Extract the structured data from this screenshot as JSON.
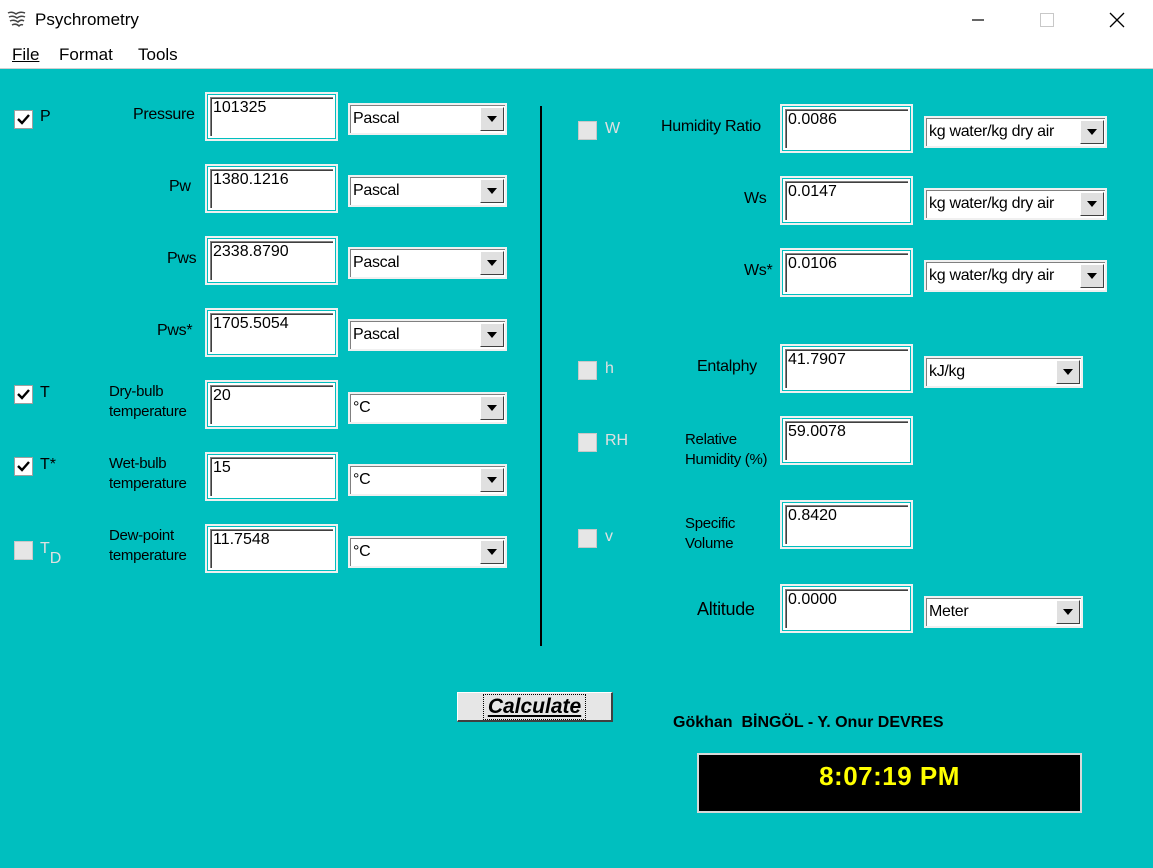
{
  "window": {
    "title": "Psychrometry"
  },
  "menu": {
    "items": [
      "File",
      "Format",
      "Tools"
    ]
  },
  "left": {
    "checks": [
      {
        "label": "P",
        "checked": true
      },
      {
        "label": "T",
        "checked": true
      },
      {
        "label": "T*",
        "checked": true
      },
      {
        "label": "T",
        "sub": "D",
        "checked": false
      }
    ],
    "rows": [
      {
        "label": "Pressure",
        "value": "101325",
        "unit": "Pascal"
      },
      {
        "label": "Pw",
        "value": "1380.1216",
        "unit": "Pascal"
      },
      {
        "label": "Pws",
        "value": "2338.8790",
        "unit": "Pascal"
      },
      {
        "label": "Pws*",
        "value": "1705.5054",
        "unit": "Pascal"
      },
      {
        "label1": "Dry-bulb",
        "label2": "temperature",
        "value": "20",
        "unit": "°C"
      },
      {
        "label1": "Wet-bulb",
        "label2": "temperature",
        "value": "15",
        "unit": "°C"
      },
      {
        "label1": "Dew-point",
        "label2": "temperature",
        "value": "11.7548",
        "unit": "°C"
      }
    ]
  },
  "right": {
    "checks": [
      {
        "label": "W",
        "checked": false
      },
      {
        "label": "h",
        "checked": false
      },
      {
        "label": "RH",
        "checked": false
      },
      {
        "label": "v",
        "checked": false
      }
    ],
    "rows": [
      {
        "label": "Humidity Ratio",
        "value": "0.0086",
        "unit": "kg water/kg dry air"
      },
      {
        "label": "Ws",
        "value": "0.0147",
        "unit": "kg water/kg dry air"
      },
      {
        "label": "Ws*",
        "value": "0.0106",
        "unit": "kg water/kg dry air"
      },
      {
        "label": "Entalphy",
        "value": "41.7907",
        "unit": "kJ/kg"
      },
      {
        "label1": "Relative",
        "label2": "Humidity (%)",
        "value": "59.0078"
      },
      {
        "label1": "Specific",
        "label2": "Volume",
        "value": "0.8420"
      },
      {
        "label": "Altitude",
        "value": "0.0000",
        "unit": "Meter"
      }
    ]
  },
  "calculate_label": "Calculate",
  "authors": "Gökhan  BİNGÖL - Y. Onur DEVRES",
  "clock": "8:07:19 PM",
  "colors": {
    "background": "#00bfbf",
    "clock_text": "#ffff00",
    "clock_bg": "#000000"
  },
  "icons": [
    "app-icon",
    "minimize-icon",
    "maximize-icon",
    "close-icon",
    "dropdown-arrow-icon",
    "checkmark-icon"
  ]
}
